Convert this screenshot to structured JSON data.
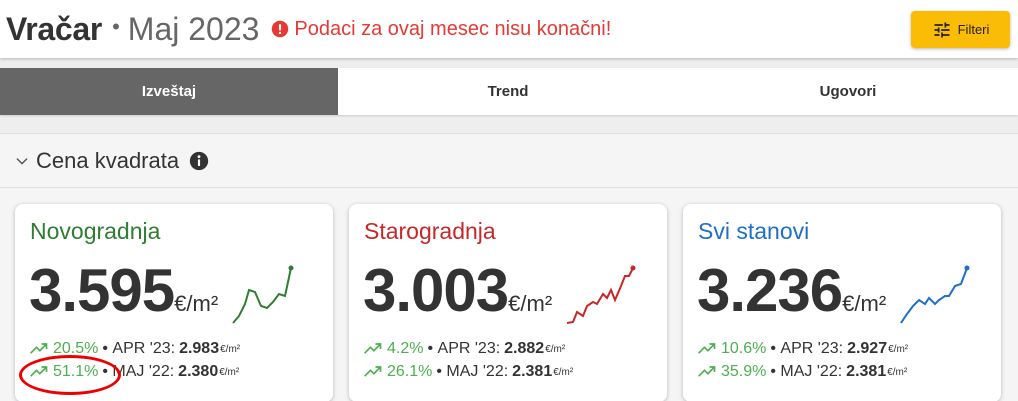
{
  "header": {
    "place": "Vračar",
    "separator": "•",
    "date": "Maj 2023",
    "warning": "Podaci za ovaj mesec nisu konačni!",
    "filter_label": "Filteri"
  },
  "tabs": [
    {
      "label": "Izveštaj",
      "active": true
    },
    {
      "label": "Trend",
      "active": false
    },
    {
      "label": "Ugovori",
      "active": false
    }
  ],
  "section": {
    "title": "Cena kvadrata"
  },
  "cards": [
    {
      "title": "Novogradnja",
      "color": "#2e7d32",
      "price": "3.595",
      "unit": "€/m²",
      "stats": [
        {
          "pct": "20.5%",
          "label": "APR '23:",
          "value": "2.983",
          "unit": "€/m²"
        },
        {
          "pct": "51.1%",
          "label": "MAJ '22:",
          "value": "2.380",
          "unit": "€/m²"
        }
      ]
    },
    {
      "title": "Starogradnja",
      "color": "#c62828",
      "price": "3.003",
      "unit": "€/m²",
      "stats": [
        {
          "pct": "4.2%",
          "label": "APR '23:",
          "value": "2.882",
          "unit": "€/m²"
        },
        {
          "pct": "26.1%",
          "label": "MAJ '22:",
          "value": "2.381",
          "unit": "€/m²"
        }
      ]
    },
    {
      "title": "Svi stanovi",
      "color": "#1e6fc8",
      "price": "3.236",
      "unit": "€/m²",
      "stats": [
        {
          "pct": "10.6%",
          "label": "APR '23:",
          "value": "2.927",
          "unit": "€/m²"
        },
        {
          "pct": "35.9%",
          "label": "MAJ '22:",
          "value": "2.381",
          "unit": "€/m²"
        }
      ]
    }
  ],
  "colors": {
    "accent_button": "#fbbc05",
    "warning": "#e53935",
    "trend_up": "#4caf50",
    "active_tab": "#666666",
    "annotation_circle": "#ee0000"
  }
}
